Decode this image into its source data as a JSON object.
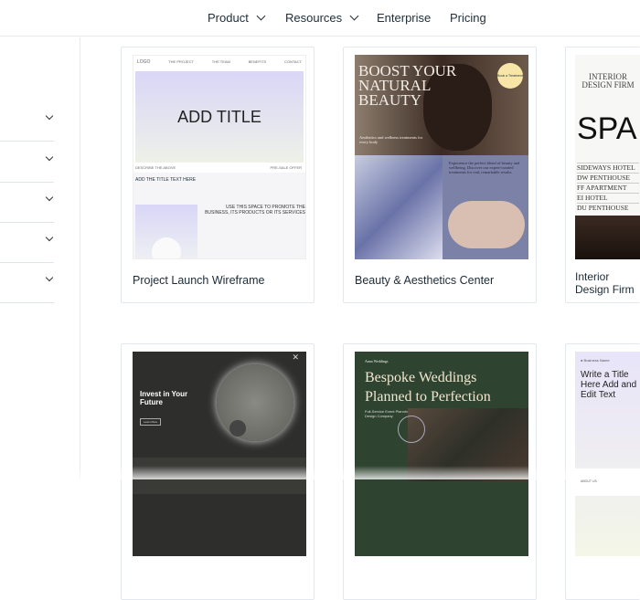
{
  "nav": {
    "items": [
      {
        "label": "Product",
        "dropdown": true
      },
      {
        "label": "Resources",
        "dropdown": true
      },
      {
        "label": "Enterprise"
      },
      {
        "label": "Pricing"
      }
    ]
  },
  "sidebar": {
    "rows": 5
  },
  "templates": [
    {
      "name": "Project Launch Wireframe",
      "thumb": {
        "logo": "LOGO",
        "links": [
          "THE PROJECT",
          "THE TEAM",
          "BENEFITS",
          "CONTACT"
        ],
        "title": "ADD TITLE",
        "sub_left": "DESCRIBE THE ABOVE",
        "sub_right": "PRE-SALE OFFER",
        "heading": "ADD THE TITLE TEXT HERE",
        "promo": "USE THIS SPACE TO PROMOTE THE BUSINESS, ITS PRODUCTS OR ITS SERVICES"
      }
    },
    {
      "name": "Beauty & Aesthetics Center",
      "thumb": {
        "title": "BOOST YOUR NATURAL BEAUTY",
        "badge": "Book a Treatment",
        "tagline": "Aesthetics and wellness treatments for every body",
        "body": "Experience the perfect blend of beauty and wellbeing. Discover our expert-curated treatments for real, remarkable results."
      }
    },
    {
      "name": "Interior Design Firm",
      "thumb": {
        "title": "INTERIOR DESIGN FIRM",
        "big": "SPA",
        "list": [
          "SIDEWAYS HOTEL",
          "DW PENTHOUSE",
          "FF APARTMENT",
          "EI HOTEL",
          "DU PENTHOUSE"
        ]
      }
    },
    {
      "name": "",
      "thumb": {
        "title": "Invest in Your Future",
        "button": "Learn More"
      }
    },
    {
      "name": "",
      "thumb": {
        "brand": "Anna Weddings",
        "title": "Bespoke Weddings Planned to Perfection",
        "sub": "Full-Service Event Planning & Design Company"
      }
    },
    {
      "name": "",
      "thumb": {
        "brand": "Business Name",
        "title": "Write a Title Here Add and Edit Text",
        "section": "ABOUT US"
      }
    }
  ]
}
